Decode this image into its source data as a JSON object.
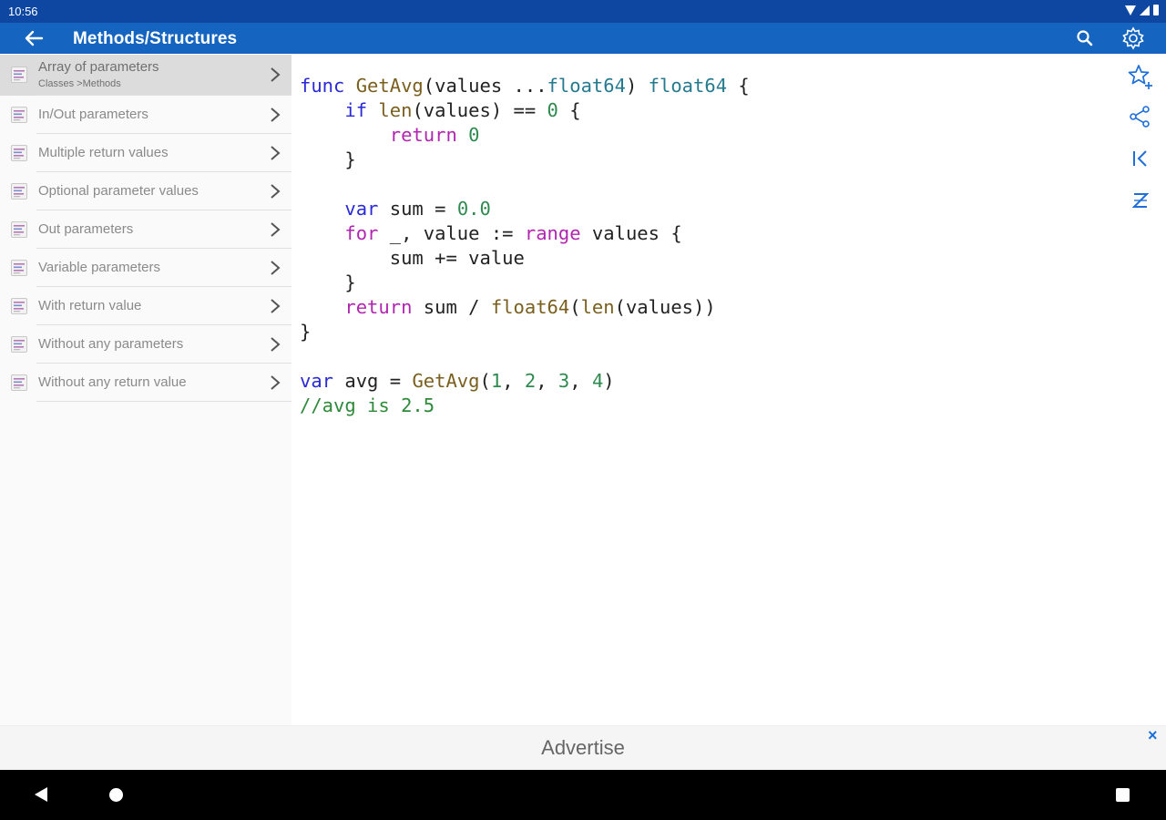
{
  "status_bar": {
    "time": "10:56"
  },
  "app_bar": {
    "title": "Methods/Structures",
    "back_icon": "arrow-left-icon",
    "search_icon": "search-icon",
    "settings_icon": "gear-icon"
  },
  "sidebar": {
    "items": [
      {
        "label": "Array of parameters",
        "sublabel": "Classes >Methods",
        "selected": true
      },
      {
        "label": "In/Out parameters"
      },
      {
        "label": "Multiple return values"
      },
      {
        "label": "Optional parameter values"
      },
      {
        "label": "Out parameters"
      },
      {
        "label": "Variable parameters"
      },
      {
        "label": "With return value"
      },
      {
        "label": "Without any parameters"
      },
      {
        "label": "Without any return value"
      }
    ]
  },
  "code": {
    "language": "go",
    "lines": [
      "func GetAvg(values ...float64) float64 {",
      "    if len(values) == 0 {",
      "        return 0",
      "    }",
      "",
      "    var sum = 0.0",
      "    for _, value := range values {",
      "        sum += value",
      "    }",
      "    return sum / float64(len(values))",
      "}",
      "",
      "var avg = GetAvg(1, 2, 3, 4)",
      "//avg is 2.5"
    ]
  },
  "side_actions": {
    "favorite_icon": "star-plus-icon",
    "share_icon": "share-icon",
    "first_icon": "skip-first-icon",
    "sort_icon": "sort-az-icon"
  },
  "ad_bar": {
    "text": "Advertise",
    "close_label": "×"
  },
  "colors": {
    "status_bar": "#0d47a1",
    "app_bar": "#1565c0",
    "accent": "#1e6fd9",
    "keyword": "#2a2ad6",
    "keyword_control": "#b026b0",
    "function": "#7a5f1e",
    "type": "#267a90",
    "number": "#2e8a4f",
    "comment": "#2e8a3a"
  }
}
